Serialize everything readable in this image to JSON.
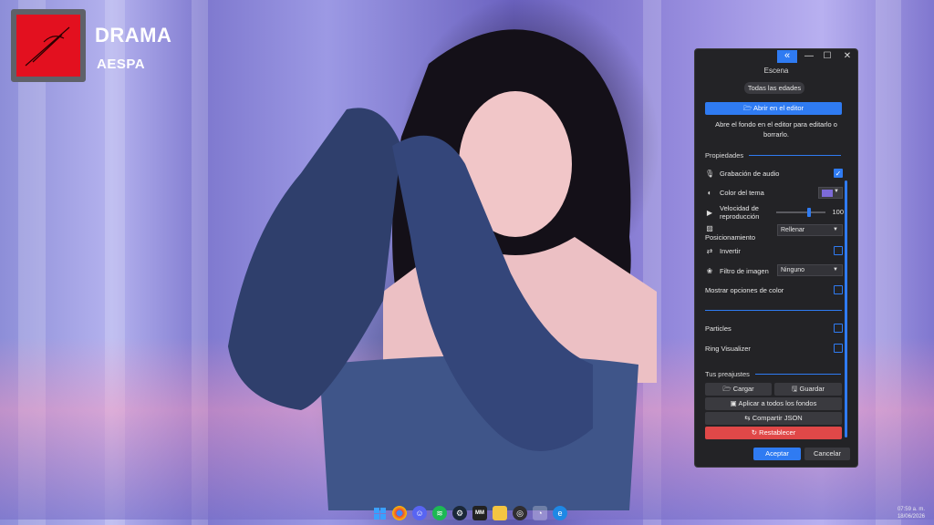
{
  "colors": {
    "accent": "#2f7bf2",
    "panel_bg": "#232326",
    "danger": "#e04848",
    "theme_color": "#7c6ad8",
    "album_red": "#e3101f"
  },
  "album": {
    "title": "DRAMA",
    "artist": "AESPA"
  },
  "window": {
    "collapse_icon": "«",
    "minimize_icon": "—",
    "maximize_icon": "☐",
    "close_icon": "✕",
    "title": "Escena"
  },
  "scene": {
    "rating_label": "Todas las edades",
    "open_editor_label": "Abrir en el editor",
    "editor_description": "Abre el fondo en el editor para editarlo o borrarlo."
  },
  "properties": {
    "header": "Propiedades",
    "audio_recording": {
      "label": "Grabación de audio",
      "checked": true
    },
    "theme_color": {
      "label": "Color del tema"
    },
    "playback_speed": {
      "label": "Velocidad de reproducción",
      "value": "100"
    },
    "positioning": {
      "label": "Posicionamiento",
      "selected": "Rellenar"
    },
    "invert": {
      "label": "Invertir",
      "checked": false
    },
    "image_filter": {
      "label": "Filtro de imagen",
      "selected": "Ninguno"
    },
    "show_color_options": {
      "label": "Mostrar opciones de color",
      "checked": false
    },
    "particles": {
      "label": "Particles",
      "checked": false
    },
    "ring_visualizer": {
      "label": "Ring Visualizer",
      "checked": false
    }
  },
  "presets": {
    "header": "Tus preajustes",
    "load_label": "Cargar",
    "save_label": "Guardar",
    "apply_all_label": "Aplicar a todos los fondos",
    "share_json_label": "Compartir JSON",
    "reset_label": "Restablecer"
  },
  "footer": {
    "accept_label": "Aceptar",
    "cancel_label": "Cancelar"
  },
  "taskbar": {
    "icons": [
      "windows-icon",
      "chrome-icon",
      "discord-icon",
      "spotify-icon",
      "steam-icon",
      "mm-icon",
      "file-explorer-icon",
      "obs-icon",
      "wallpaper-engine-icon",
      "edge-icon"
    ],
    "mm_label": "MM"
  },
  "clock": {
    "time": "07:59 a. m.",
    "date": "18/06/2026"
  }
}
